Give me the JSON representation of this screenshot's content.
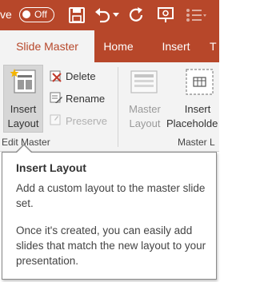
{
  "qat": {
    "autosave_partial": "ve",
    "autosave_state": "Off"
  },
  "tabs": [
    {
      "label": "Slide Master",
      "active": true
    },
    {
      "label": "Home",
      "active": false
    },
    {
      "label": "Insert",
      "active": false
    },
    {
      "label": "T",
      "active": false
    }
  ],
  "ribbon": {
    "insert_layout": {
      "line1": "Insert",
      "line2": "Layout"
    },
    "delete_label": "Delete",
    "rename_label": "Rename",
    "preserve_label": "Preserve",
    "master_layout": {
      "line1": "Master",
      "line2": "Layout"
    },
    "insert_placeholder": {
      "line1": "Insert",
      "line2": "Placeholde"
    },
    "group_edit_master": "Edit Master",
    "group_master_layout": "Master L"
  },
  "tooltip": {
    "title": "Insert Layout",
    "para1": "Add a custom layout to the master slide set.",
    "para2": "Once it's created, you can easily add slides that match the new layout to your presentation."
  },
  "colors": {
    "accent": "#b7472a",
    "ribbon_bg": "#f3f3f3"
  }
}
